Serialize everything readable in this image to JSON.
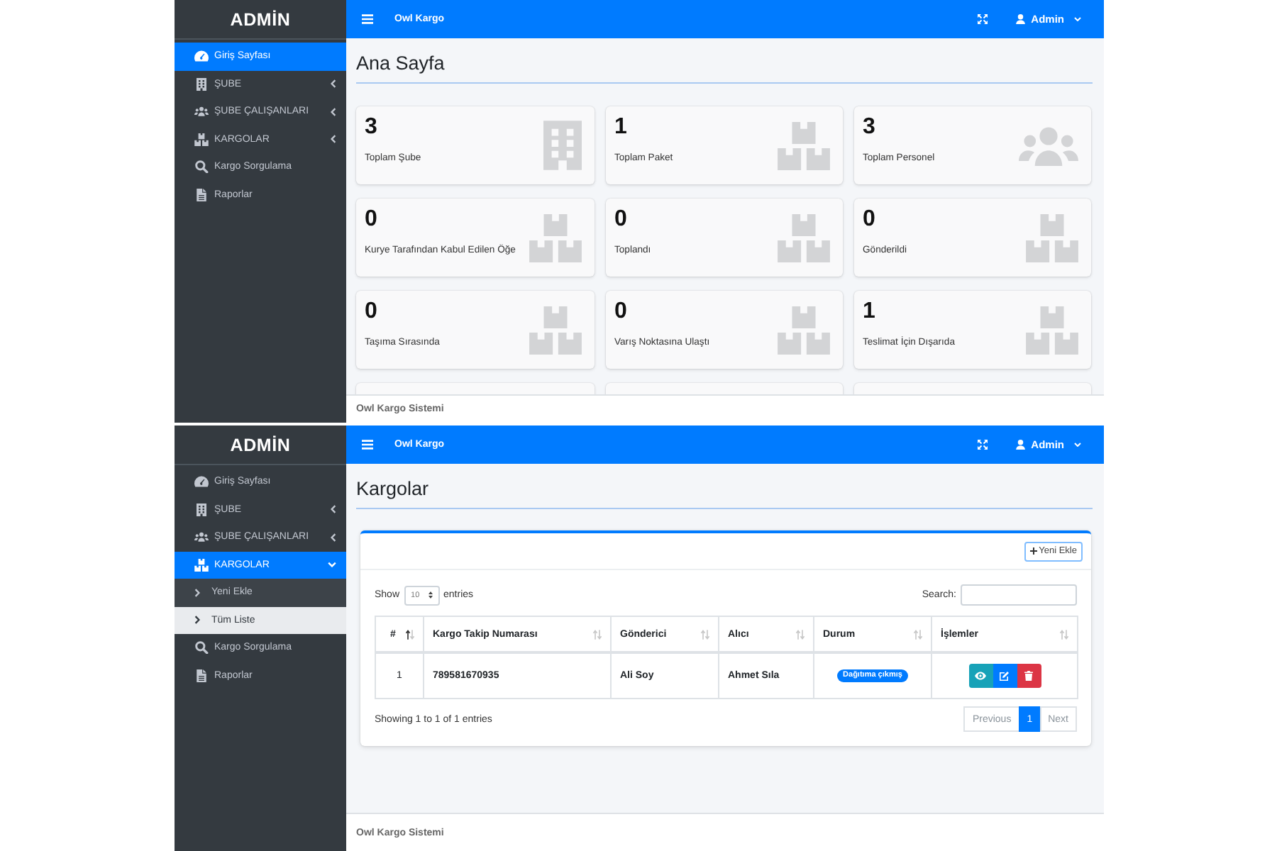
{
  "panels": [
    {
      "sidebar": {
        "brand": "ADMİN",
        "items": [
          {
            "label": "Giriş Sayfası",
            "kind": "link",
            "selected": true
          },
          {
            "label": "ŞUBE",
            "kind": "menu",
            "selected": false,
            "expanded": false
          },
          {
            "label": "ŞUBE ÇALIŞANLARI",
            "kind": "menu",
            "selected": false,
            "expanded": false
          },
          {
            "label": "KARGOLAR",
            "kind": "menu",
            "selected": false,
            "expanded": false
          },
          {
            "label": "Kargo Sorgulama",
            "kind": "link",
            "selected": false
          },
          {
            "label": "Raporlar",
            "kind": "link",
            "selected": false
          }
        ]
      },
      "navbar": {
        "title": "Owl Kargo",
        "user": "Admin"
      },
      "content": {
        "kind": "dashboard",
        "page_title": "Ana Sayfa",
        "stats": [
          {
            "value": "3",
            "label": "Toplam Şube"
          },
          {
            "value": "1",
            "label": "Toplam Paket"
          },
          {
            "value": "3",
            "label": "Toplam Personel"
          },
          {
            "value": "0",
            "label": "Kurye Tarafından Kabul Edilen Öğe"
          },
          {
            "value": "0",
            "label": "Toplandı"
          },
          {
            "value": "0",
            "label": "Gönderildi"
          },
          {
            "value": "0",
            "label": "Taşıma Sırasında"
          },
          {
            "value": "0",
            "label": "Varış Noktasına Ulaştı"
          },
          {
            "value": "1",
            "label": "Teslimat İçin Dışarıda"
          }
        ]
      },
      "footer": "Owl Kargo Sistemi"
    },
    {
      "sidebar": {
        "brand": "ADMİN",
        "items": [
          {
            "label": "Giriş Sayfası",
            "kind": "link",
            "selected": false
          },
          {
            "label": "ŞUBE",
            "kind": "menu",
            "selected": false,
            "expanded": false
          },
          {
            "label": "ŞUBE ÇALIŞANLARI",
            "kind": "menu",
            "selected": false,
            "expanded": false
          },
          {
            "label": "KARGOLAR",
            "kind": "menu",
            "selected": true,
            "expanded": true,
            "children": [
              {
                "label": "Yeni Ekle",
                "selected": false
              },
              {
                "label": "Tüm Liste",
                "selected": true
              }
            ]
          },
          {
            "label": "Kargo Sorgulama",
            "kind": "link",
            "selected": false
          },
          {
            "label": "Raporlar",
            "kind": "link",
            "selected": false
          }
        ]
      },
      "navbar": {
        "title": "Owl Kargo",
        "user": "Admin"
      },
      "content": {
        "kind": "list",
        "page_title": "Kargolar",
        "add_button": "Yeni Ekle",
        "show_label": "Show",
        "page_length": "10",
        "entries_label": "entries",
        "search_label": "Search:",
        "table": {
          "columns": [
            {
              "label": "#",
              "sorted": true
            },
            {
              "label": "Kargo Takip Numarası",
              "sorted": false
            },
            {
              "label": "Gönderici",
              "sorted": false
            },
            {
              "label": "Alıcı",
              "sorted": false
            },
            {
              "label": "Durum",
              "sorted": false
            },
            {
              "label": "İşlemler",
              "sorted": false
            }
          ],
          "rows": [
            {
              "cells": [
                "1",
                "789581670935",
                "Ali Soy",
                "Ahmet Sıla"
              ],
              "status": "Dağıtıma çıkmış"
            }
          ]
        },
        "info": "Showing 1 to 1 of 1 entries",
        "pagination": [
          {
            "label": "Previous",
            "selected": false,
            "disabled": true
          },
          {
            "label": "1",
            "selected": true,
            "disabled": false
          },
          {
            "label": "Next",
            "selected": false,
            "disabled": true
          }
        ]
      },
      "footer": "Owl Kargo Sistemi"
    }
  ]
}
